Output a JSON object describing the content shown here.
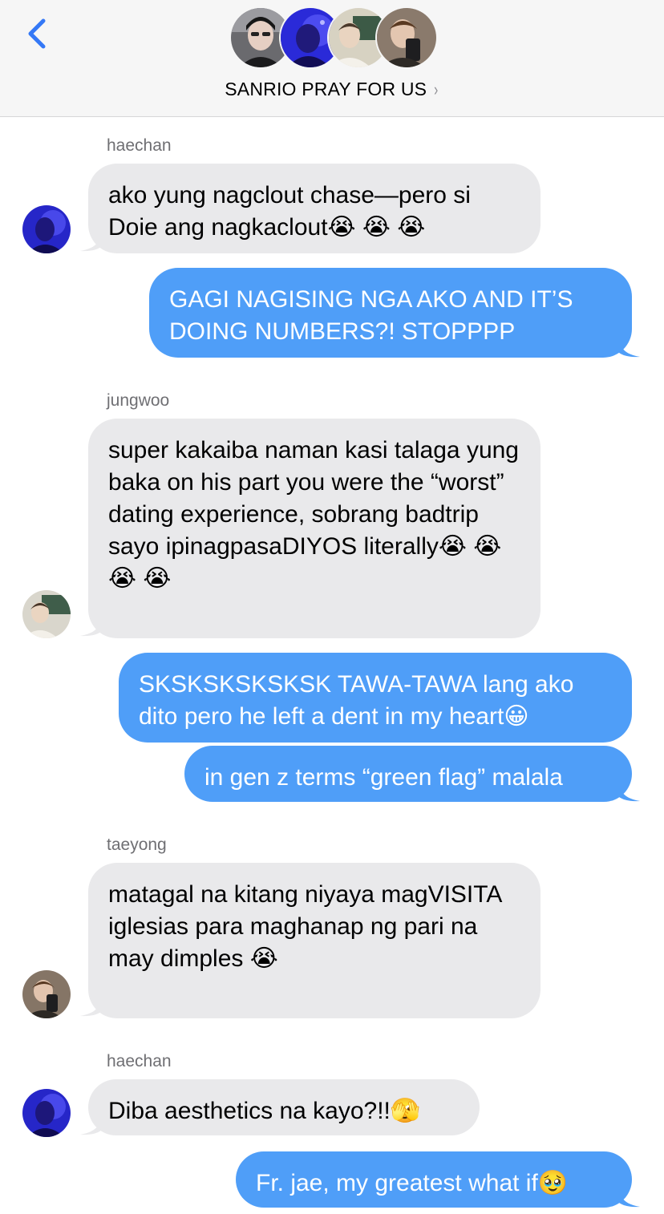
{
  "header": {
    "group_name": "SANRIO PRAY FOR US",
    "chevron": "›",
    "back_icon": "chevron-left-icon",
    "accent": "#3478f6"
  },
  "colors": {
    "incoming_bubble": "#e9e9eb",
    "outgoing_bubble": "#4f9ef8"
  },
  "messages": [
    {
      "sender": "haechan",
      "direction": "incoming",
      "text": "ako yung nagclout chase—pero si Doie ang nagkaclout😭 😭 😭"
    },
    {
      "direction": "outgoing",
      "text": "GAGI NAGISING NGA AKO AND IT’S DOING NUMBERS?! STOPPPP"
    },
    {
      "sender": "jungwoo",
      "direction": "incoming",
      "text": "super kakaiba naman kasi talaga yung baka on his part you were the “worst” dating experience, sobrang badtrip sayo ipinagpasaDIYOS literally😭 😭 😭 😭"
    },
    {
      "direction": "outgoing",
      "text": "SKSKSKSKSKSK TAWA-TAWA lang ako dito pero he left a dent in my heart😀"
    },
    {
      "direction": "outgoing",
      "text": "in gen z terms “green flag” malala"
    },
    {
      "sender": "taeyong",
      "direction": "incoming",
      "text": "matagal na kitang niyaya magVISITA iglesias para maghanap ng pari na may dimples 😭"
    },
    {
      "sender": "haechan",
      "direction": "incoming",
      "text": "Diba aesthetics na kayo?!!🫣"
    },
    {
      "direction": "outgoing",
      "text": "Fr. jae, my greatest what if🥹"
    }
  ]
}
